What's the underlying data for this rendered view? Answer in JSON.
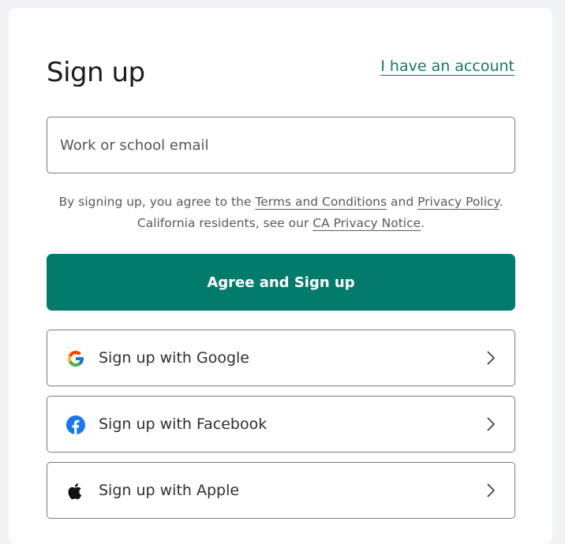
{
  "header": {
    "title": "Sign up",
    "account_link": "I have an account"
  },
  "form": {
    "email_placeholder": "Work or school email"
  },
  "legal": {
    "prefix": "By signing up, you agree to the ",
    "terms_link": "Terms and Conditions",
    "and": " and ",
    "privacy_link": "Privacy Policy",
    "line2_prefix": ". California residents, see our ",
    "ca_link": "CA Privacy Notice",
    "suffix": "."
  },
  "primary_button": {
    "label": "Agree and Sign up"
  },
  "social": [
    {
      "label": "Sign up with Google",
      "icon": "google-icon"
    },
    {
      "label": "Sign up with Facebook",
      "icon": "facebook-icon"
    },
    {
      "label": "Sign up with Apple",
      "icon": "apple-icon"
    }
  ],
  "colors": {
    "accent": "#037b6c",
    "link": "#0f7b65",
    "facebook": "#1877f2"
  }
}
